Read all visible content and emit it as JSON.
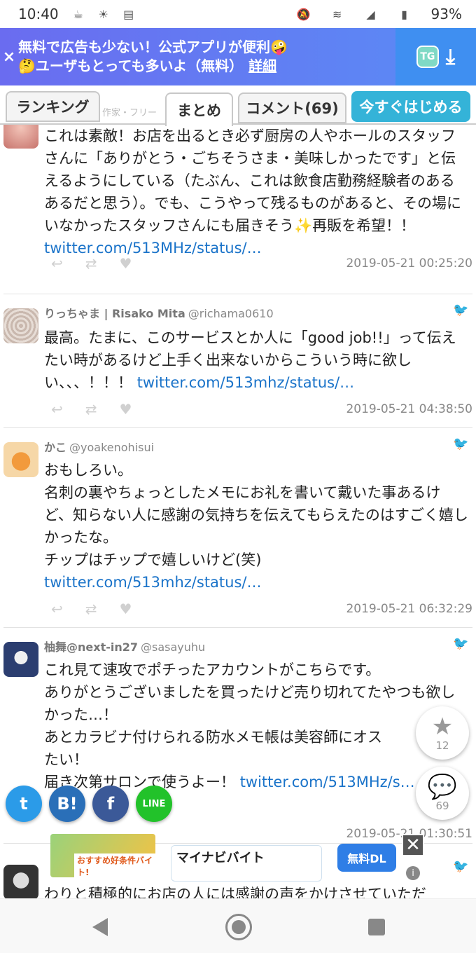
{
  "status_bar": {
    "time": "10:40",
    "battery": "93%"
  },
  "ad_banner": {
    "line1": "無料で広告も少ない！公式アプリが便利🤪",
    "line2": "🤔ユーザもとっても多いよ（無料）",
    "link": "詳細",
    "close": "×",
    "app_icon": "TG",
    "download_icon": "⤓"
  },
  "tabs": {
    "ranking": "ランキング",
    "faded": "作家・フリー",
    "matome": "まとめ",
    "comment": "コメント(69)",
    "start": "今すぐはじめる"
  },
  "tweets": [
    {
      "name": "",
      "handle": "",
      "text": "これは素敵！お店を出るとき必ず厨房の人やホールのスタッフさんに「ありがとう・ごちそうさま・美味しかったです」と伝えるようにしている（たぶん、これは飲食店勤務経験者のあるあるだと思う）。でも、こうやって残るものがあると、その場にいなかったスタッフさんにも届きそう✨再販を希望！！ ",
      "link": "twitter.com/513MHz/status/…",
      "timestamp": "2019-05-21 00:25:20"
    },
    {
      "name": "りっちゃま | Risako Mita",
      "handle": "@richama0610",
      "text": "最高。たまに、このサービスとか人に「good job!!」って伝えたい時があるけど上手く出来ないからこういう時に欲しい、、、！！！ ",
      "link": "twitter.com/513mhz/status/…",
      "timestamp": "2019-05-21 04:38:50"
    },
    {
      "name": "かこ",
      "handle": "@yoakenohisui",
      "text": "おもしろい。\n名刺の裏やちょっとしたメモにお礼を書いて戴いた事あるけど、知らない人に感謝の気持ちを伝えてもらえたのはすごく嬉しかったな。\nチップはチップで嬉しいけど(笑)\n",
      "link": "twitter.com/513mhz/status/…",
      "timestamp": "2019-05-21 06:32:29"
    },
    {
      "name": "柚舞@next-in27",
      "handle": "@sasayuhu",
      "text": "これ見て速攻でポチったアカウントがこちらです。\nありがとうございましたを買ったけど売り切れてたやつも欲しかった…！\nあとカラビナ付けられる防水メモ帳は美容師にオス\nたい！\n届き次第サロンで使うよー！ ",
      "link": "twitter.com/513MHz/s…",
      "timestamp": "2019-05-21 01:30:51"
    },
    {
      "name": "",
      "handle": "",
      "text": "わりと積極的にお店の人には感謝の声をかけさせていただ",
      "link": "",
      "timestamp": ""
    }
  ],
  "fab": {
    "favorites": "12",
    "comments": "69"
  },
  "share": {
    "twitter": "t",
    "hatena": "B!",
    "facebook": "f",
    "line": "LINE"
  },
  "bottom_ad": {
    "image_label": "おすすめ好条件バイト!",
    "title": "マイナビバイト",
    "cta": "無料DL",
    "close": "✕",
    "info": "i"
  },
  "colors": {
    "accent": "#34b3d8",
    "link": "#1a73c9",
    "banner": "#6a6cf0"
  }
}
